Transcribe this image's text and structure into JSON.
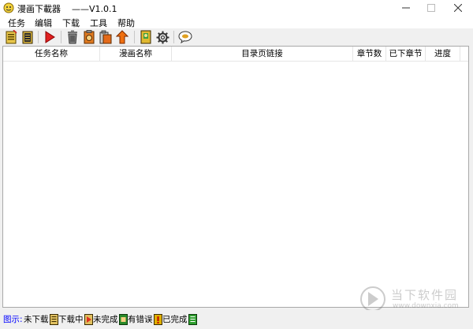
{
  "window": {
    "title": "漫画下載器    ——V1.0.1"
  },
  "menu": [
    "任务",
    "编辑",
    "下载",
    "工具",
    "帮助"
  ],
  "toolbar": {
    "icons": [
      "new-task-icon",
      "task-list-icon",
      "start-download-icon",
      "delete-icon",
      "clipboard-copy-icon",
      "paste-icon",
      "move-up-icon",
      "book-icon",
      "settings-icon",
      "about-icon"
    ]
  },
  "table": {
    "columns": [
      "任务名称",
      "漫画名称",
      "目录页链接",
      "章节数",
      "已下章节",
      "进度"
    ],
    "rows": []
  },
  "status": {
    "legend_title": "图示:",
    "legend": [
      {
        "label": "未下载",
        "color": "#e0c060"
      },
      {
        "label": "下载中",
        "color": "#e03020"
      },
      {
        "label": "未完成",
        "color": "#2a8a2a"
      },
      {
        "label": "有错误",
        "color": "#e0b000"
      },
      {
        "label": "已完成",
        "color": "#30a030"
      }
    ]
  },
  "watermark": {
    "text_cn": "当下软件园",
    "text_en": "www.downxia.com"
  }
}
